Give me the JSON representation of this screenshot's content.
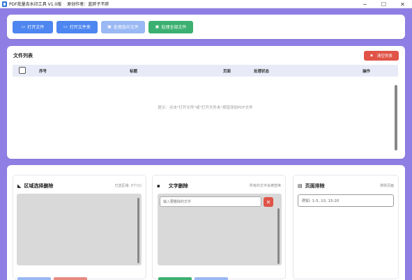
{
  "window": {
    "title": "PDF批量去水印工具 V1.0版",
    "author": "原创作者：蓝胖子不胖",
    "controls": {
      "minimize": "─",
      "maximize": "☐",
      "close": "✕"
    }
  },
  "toolbar": {
    "open_file": "打开文件",
    "open_folder": "打开文件夹",
    "process_selected": "处理选中文件",
    "process_all": "处理全部文件"
  },
  "file_list": {
    "title": "文件列表",
    "clear_button": "清空列表",
    "columns": {
      "index": "序号",
      "title": "标题",
      "pages": "页面",
      "status": "处理状态",
      "actions": "操作"
    },
    "empty_hint": "提示：点击\"打开文件\"或\"打开文件夹\"按钮添加PDF文件"
  },
  "region_delete": {
    "title": "区域选择删除",
    "note": "已选区域: 0个(1)"
  },
  "text_delete": {
    "title": "文字删除",
    "note": "所有的文字会被替换",
    "input_placeholder": "输入要删除的文字",
    "delete_label": "✕"
  },
  "page_exclude": {
    "title": "页面排除",
    "note": "排除页面",
    "input_placeholder": "例如: 1-5, 10, 15-20"
  },
  "colors": {
    "background": "#8f7fe4",
    "primary": "#4d86f0",
    "primary_light": "#9ab8f4",
    "success": "#3cb070",
    "danger": "#e05346"
  }
}
